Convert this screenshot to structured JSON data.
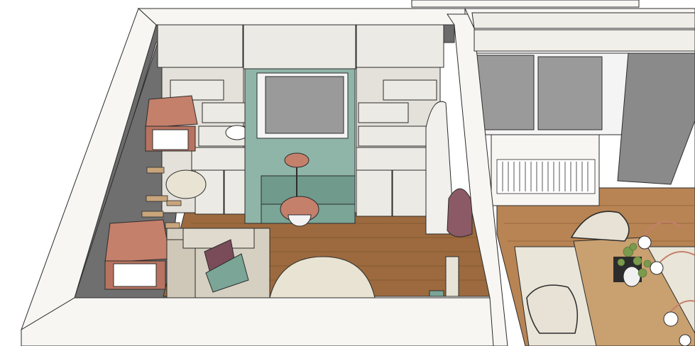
{
  "image": {
    "kind": "3D interior render (sketch style), top-down cutaway view",
    "palette": {
      "wall": "#f7f6f3",
      "wall_edge": "#2c2c2c",
      "floor_wood": "#9c6a3e",
      "floor_wood_light": "#b88454",
      "cabinet": "#eceae4",
      "alcove_green": "#8fb5a8",
      "terracotta": "#c4806b",
      "window_glass": "#9a9a9a",
      "rug": "#e8e3d2",
      "sofa": "#d6d0c2",
      "dark_wall": "#6a6a6a"
    }
  }
}
